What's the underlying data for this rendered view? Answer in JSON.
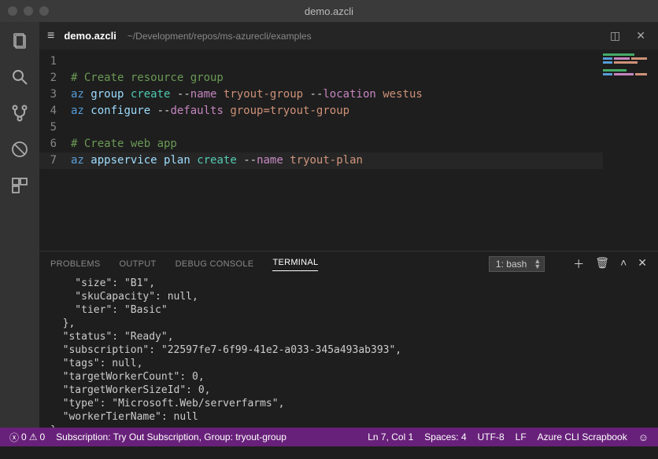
{
  "title": "demo.azcli",
  "tab": {
    "filename": "demo.azcli",
    "path": "~/Development/repos/ms-azurecli/examples"
  },
  "editor": {
    "lines": [
      "1",
      "2",
      "3",
      "4",
      "5",
      "6",
      "7"
    ]
  },
  "code": {
    "l1_comment": "# Create resource group",
    "l2_cmd": "az",
    "l2_sub": "group",
    "l2_verb": "create",
    "l2_flag1": "name",
    "l2_val1": "tryout-group",
    "l2_flag2": "location",
    "l2_val2": "westus",
    "l3_cmd": "az",
    "l3_sub": "configure",
    "l3_flag": "defaults",
    "l3_val": "group=tryout-group",
    "l5_comment": "# Create web app",
    "l6_cmd": "az",
    "l6_sub": "appservice",
    "l6_sub2": "plan",
    "l6_verb": "create",
    "l6_flag": "name",
    "l6_val": "tryout-plan"
  },
  "panel": {
    "tabs": {
      "problems": "PROBLEMS",
      "output": "OUTPUT",
      "debug": "DEBUG CONSOLE",
      "terminal": "TERMINAL"
    },
    "select": "1: bash"
  },
  "terminal_output": "    \"size\": \"B1\",\n    \"skuCapacity\": null,\n    \"tier\": \"Basic\"\n  },\n  \"status\": \"Ready\",\n  \"subscription\": \"22597fe7-6f99-41e2-a033-345a493ab393\",\n  \"tags\": null,\n  \"targetWorkerCount\": 0,\n  \"targetWorkerSizeId\": 0,\n  \"type\": \"Microsoft.Web/serverfarms\",\n  \"workerTierName\": null\n}\n$ ▯",
  "status": {
    "errors": "0",
    "warnings": "0",
    "subscription": "Subscription: Try Out Subscription, Group: tryout-group",
    "cursor": "Ln 7, Col 1",
    "spaces": "Spaces: 4",
    "encoding": "UTF-8",
    "eol": "LF",
    "lang": "Azure CLI Scrapbook"
  }
}
